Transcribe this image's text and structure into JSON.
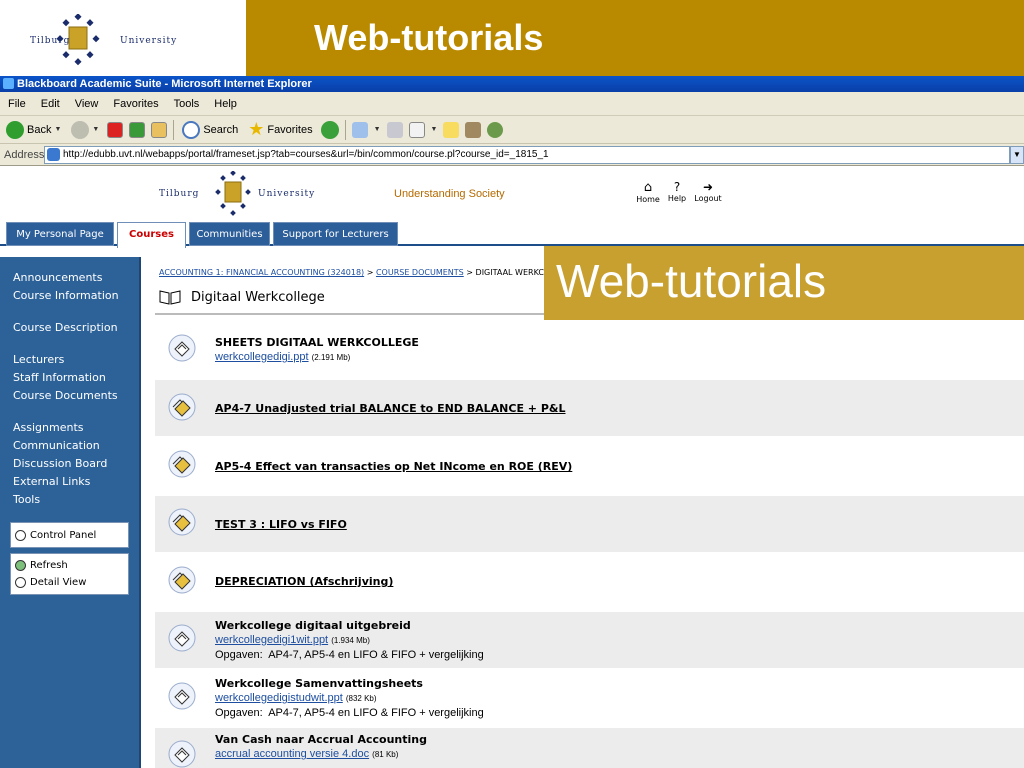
{
  "slide": {
    "title": "Web-tutorials",
    "logo_left": "Tilburg",
    "logo_right": "University",
    "colors": {
      "title_bar": "#b98a00",
      "overlay": "#c8a030"
    }
  },
  "browser": {
    "window_title": "Blackboard Academic Suite - Microsoft Internet Explorer",
    "menu": [
      "File",
      "Edit",
      "View",
      "Favorites",
      "Tools",
      "Help"
    ],
    "toolbar": {
      "back": "Back",
      "search": "Search",
      "favorites": "Favorites"
    },
    "address_label": "Address",
    "url": "http://edubb.uvt.nl/webapps/portal/frameset.jsp?tab=courses&url=/bin/common/course.pl?course_id=_1815_1"
  },
  "bb_header": {
    "logo_left": "Tilburg",
    "logo_right": "University",
    "tagline": "Understanding Society",
    "icons": {
      "home": "Home",
      "help": "Help",
      "logout": "Logout"
    },
    "tabs": [
      "My Personal Page",
      "Courses",
      "Communities",
      "Support for Lecturers"
    ],
    "active_tab": "Courses"
  },
  "sidebar": {
    "links": [
      "Announcements",
      "Course Information",
      "Course Description",
      "Lecturers",
      "Staff Information",
      "Course Documents",
      "Assignments",
      "Communication",
      "Discussion Board",
      "External Links",
      "Tools"
    ],
    "control_panel": "Control Panel",
    "refresh": "Refresh",
    "detail_view": "Detail View"
  },
  "content": {
    "breadcrumb": {
      "course": "ACCOUNTING 1: FINANCIAL ACCOUNTING (324018)",
      "sep1": ">",
      "section": "COURSE DOCUMENTS",
      "sep2": ">",
      "current": "DIGITAAL WERKC"
    },
    "heading": "Digitaal Werkcollege",
    "items": [
      {
        "type": "file",
        "title": "SHEETS DIGITAAL WERKCOLLEGE",
        "file": "werkcollegedigi.ppt",
        "size": "(2.191 Mb)"
      },
      {
        "type": "folder",
        "title": "AP4-7 Unadjusted trial BALANCE to END BALANCE + P&L"
      },
      {
        "type": "folder",
        "title": "AP5-4 Effect van transacties op Net INcome en ROE (REV)"
      },
      {
        "type": "folder",
        "title": "TEST 3 : LIFO vs FIFO"
      },
      {
        "type": "folder",
        "title": "DEPRECIATION (Afschrijving)"
      },
      {
        "type": "file",
        "title": "Werkcollege digitaal uitgebreid",
        "file": "werkcollegedigi1wit.ppt",
        "size": "(1.934 Mb)",
        "note": "Opgaven:  AP4-7, AP5-4 en LIFO & FIFO + vergelijking"
      },
      {
        "type": "file",
        "title": "Werkcollege Samenvattingsheets",
        "file": "werkcollegedigistudwit.ppt",
        "size": "(832 Kb)",
        "note": "Opgaven:  AP4-7, AP5-4 en LIFO & FIFO + vergelijking"
      },
      {
        "type": "file",
        "title": "Van Cash naar Accrual Accounting",
        "file": "accrual accounting versie 4.doc",
        "size": "(81 Kb)"
      }
    ]
  },
  "overlay": {
    "text": "Web-tutorials"
  }
}
